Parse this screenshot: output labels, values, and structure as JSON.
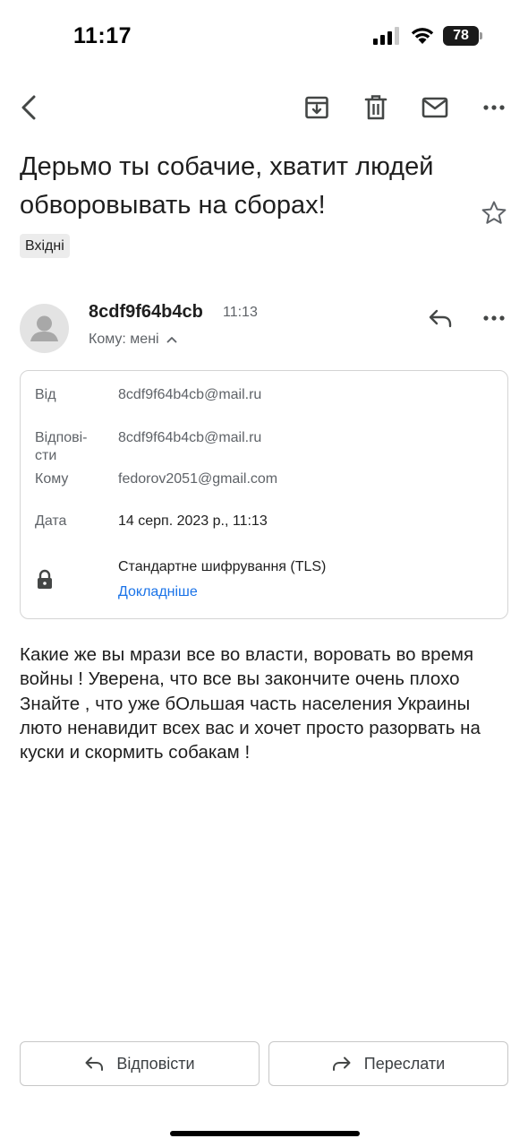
{
  "status_bar": {
    "time": "11:17",
    "battery": "78",
    "icons": [
      "signal-icon",
      "wifi-icon",
      "battery-icon"
    ]
  },
  "toolbar": {
    "icons": [
      "back-arrow-icon",
      "archive-icon",
      "trash-icon",
      "mark-unread-icon",
      "more-vertical-icon"
    ]
  },
  "email": {
    "subject": "Дерьмо ты собачие, хватит людей обворовывать на сборах!",
    "label": "Вхідні",
    "sender_name": "8cdf9f64b4cb",
    "sender_time": "11:13",
    "to_line": "Кому: мені",
    "body": "Какие же вы мрази все во власти, воровать во время войны ! Уверена, что все вы закончите очень плохо\nЗнайте , что уже бОльшая часть населения Украины люто ненавидит всех вас и хочет просто разорвать на куски и скормить собакам !"
  },
  "details": {
    "from_label": "Від",
    "from_value": "8cdf9f64b4cb@mail.ru",
    "reply_to_label_line1": "Відпові-",
    "reply_to_label_line2": "сти",
    "reply_to_value": "8cdf9f64b4cb@mail.ru",
    "to_label": "Кому",
    "to_value": "fedorov2051@gmail.com",
    "date_label": "Дата",
    "date_value": "14 серп. 2023 р., 11:13",
    "encryption": "Стандартне шифрування (TLS)",
    "learn_more": "Докладніше"
  },
  "actions": {
    "reply_label": "Відповісти",
    "forward_label": "Переслати"
  },
  "colors": {
    "link": "#1a73e8",
    "muted": "#5f6368",
    "text": "#1f1f1f"
  }
}
